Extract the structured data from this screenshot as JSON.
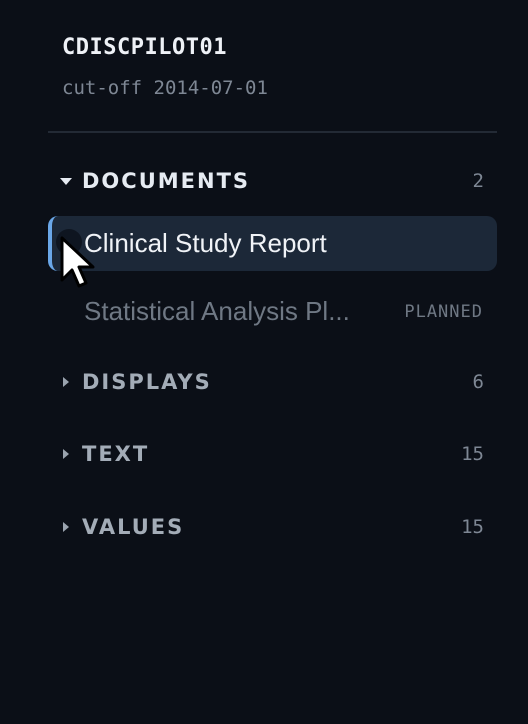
{
  "study": {
    "id": "CDISCPILOT01",
    "cutoff": "cut-off 2014-07-01"
  },
  "sections": {
    "documents": {
      "label": "DOCUMENTS",
      "count": "2",
      "expanded": true
    },
    "displays": {
      "label": "DISPLAYS",
      "count": "6",
      "expanded": false
    },
    "text": {
      "label": "TEXT",
      "count": "15",
      "expanded": false
    },
    "values": {
      "label": "VALUES",
      "count": "15",
      "expanded": false
    }
  },
  "documents": [
    {
      "title": "Clinical Study Report",
      "status": "",
      "selected": true
    },
    {
      "title": "Statistical Analysis Pl...",
      "status": "PLANNED",
      "selected": false
    }
  ],
  "colors": {
    "background": "#0b0f17",
    "selected_row": "#1c2838",
    "accent": "#6aa7e8",
    "muted_text": "#7e8794"
  },
  "icons": {
    "expanded_caret": "caret-down-icon",
    "collapsed_caret": "caret-right-icon",
    "pointer": "mouse-cursor-icon"
  }
}
